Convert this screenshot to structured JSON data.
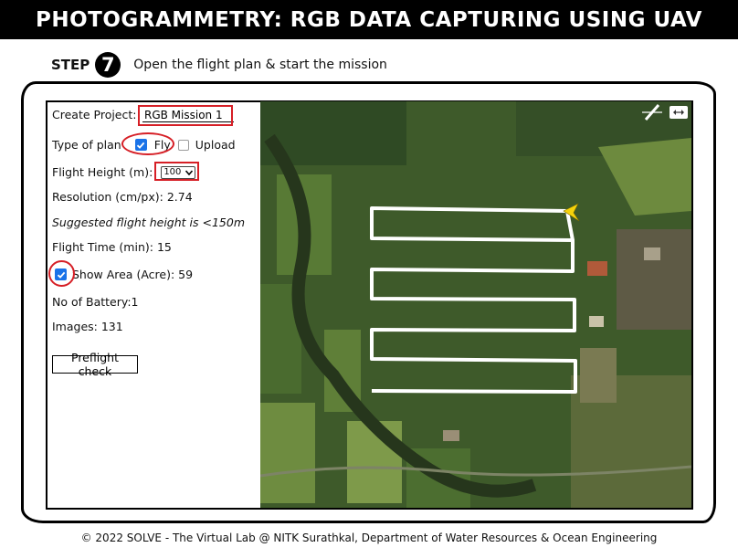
{
  "header": {
    "title": "PHOTOGRAMMETRY: RGB DATA CAPTURING USING UAV"
  },
  "step": {
    "word": "STEP",
    "number": "7",
    "instruction": "Open the flight plan & start the mission"
  },
  "panel": {
    "project_label": "Create Project:",
    "project_value": "RGB Mission 1",
    "plan_type_label": "Type of plan",
    "fly_label": "Fly",
    "fly_checked": true,
    "upload_label": "Upload",
    "upload_checked": false,
    "flight_height_label": "Flight Height (m):",
    "flight_height_value": "100",
    "resolution_text": "Resolution (cm/px): 2.74",
    "suggestion_text": "Suggested flight height is <150m",
    "flight_time_text": "Flight Time (min): 15",
    "show_area_checked": true,
    "show_area_text": "Show Area (Acre): 59",
    "battery_text": "No of Battery:1",
    "images_text": "Images: 131",
    "preflight_button": "Preflight check"
  },
  "map": {
    "icons": [
      "compass-icon",
      "expand-icon",
      "aircraft-marker-icon"
    ],
    "flight_path_color": "#ffffff",
    "marker_color": "#f5d20c"
  },
  "colors": {
    "accent": "#d61f26",
    "checkbox": "#1a73e8",
    "title_bg": "#000000"
  },
  "footer": {
    "text": "© 2022 SOLVE - The Virtual Lab @ NITK Surathkal, Department of Water Resources & Ocean Engineering"
  }
}
